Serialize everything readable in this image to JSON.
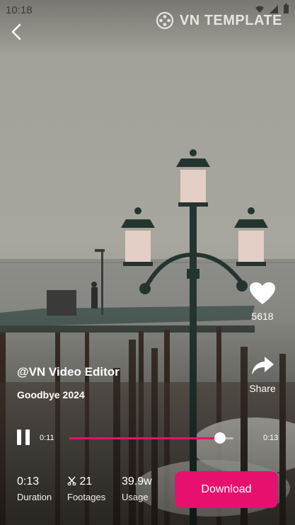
{
  "status_bar": {
    "time": "10:18"
  },
  "watermark": {
    "text": "VN TEMPLATE"
  },
  "video": {
    "author": "@VN Video Editor",
    "title": "Goodbye 2024",
    "likes": "5618",
    "share_label": "Share",
    "current_time": "0:11",
    "total_time": "0:13",
    "progress": 0.92
  },
  "stats": {
    "duration_value": "0:13",
    "duration_label": "Duration",
    "footages_value": "21",
    "footages_label": "Footages",
    "usage_value": "39.9w",
    "usage_label": "Usage"
  },
  "download": {
    "label": "Download"
  },
  "colors": {
    "accent": "#e8106e",
    "text": "#ffffff"
  },
  "icons": {
    "back": "chevron-left-icon",
    "like": "heart-icon",
    "share": "share-arrow-icon",
    "pause": "pause-icon",
    "footages": "scissors-icon",
    "watermark": "film-reel-icon"
  }
}
